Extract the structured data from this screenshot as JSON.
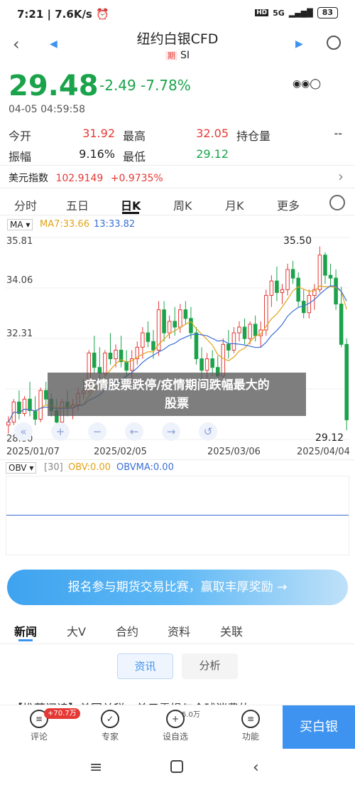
{
  "status": {
    "time": "7:21",
    "speed": "7.6K/s",
    "network": "5G",
    "battery": "83"
  },
  "header": {
    "title": "纽约白银CFD",
    "tag": "期",
    "code": "SI"
  },
  "quote": {
    "price": "29.48",
    "change": "-2.49",
    "change_pct": "-7.78%",
    "timestamp": "04-05 04:59:58"
  },
  "stats": {
    "open_label": "今开",
    "open": "31.92",
    "high_label": "最高",
    "high": "32.05",
    "oi_label": "持仓量",
    "oi": "--",
    "amp_label": "振幅",
    "amp": "9.16%",
    "low_label": "最低",
    "low": "29.12"
  },
  "usd_index": {
    "label": "美元指数",
    "value": "102.9149",
    "change": "+0.9735%"
  },
  "period_tabs": [
    "分时",
    "五日",
    "日K",
    "周K",
    "月K",
    "更多"
  ],
  "legend": {
    "ma": "MA",
    "ma7": "MA7:33.66",
    "ma_other": "13:33.82"
  },
  "y_ticks": [
    "35.81",
    "34.06",
    "32.31",
    "28.80"
  ],
  "price_labels": {
    "high": "35.50",
    "low": "29.12"
  },
  "x_dates": [
    "2025/01/07",
    "2025/02/05",
    "2025/03/06",
    "2025/04/04"
  ],
  "overlay_text": {
    "line1": "疫情股票跌停/疫情期间跌幅最大的",
    "line2": "股票"
  },
  "obv": {
    "label": "OBV",
    "param": "[30]",
    "obv": "OBV:0.00",
    "obvma": "OBVMA:0.00"
  },
  "banner": {
    "text": "报名参与期货交易比赛，赢取丰厚奖励 →"
  },
  "content_tabs": [
    "新闻",
    "大V",
    "合约",
    "资料",
    "关联"
  ],
  "sub_tabs": [
    "资讯",
    "分析"
  ],
  "news_headline": "【推荐阅读】美国关税，美元震损与全球消费的",
  "bottom_nav": [
    {
      "label": "评论",
      "badge": "+70.7万"
    },
    {
      "label": "专家"
    },
    {
      "label": "设自选",
      "badge": "5.0万"
    },
    {
      "label": "功能"
    }
  ],
  "buy_button": "买白银",
  "colors": {
    "up": "#e53935",
    "down": "#1aa34a",
    "accent": "#3e93f0"
  },
  "chart_data": {
    "type": "candlestick",
    "title": "",
    "ylim": [
      28.8,
      35.81
    ],
    "x_range": [
      "2025/01/07",
      "2025/04/04"
    ],
    "candles": [
      [
        29.3,
        29.6,
        29.0,
        29.4
      ],
      [
        29.4,
        30.2,
        29.3,
        30.1
      ],
      [
        30.1,
        30.5,
        29.5,
        29.7
      ],
      [
        29.7,
        30.3,
        29.6,
        30.2
      ],
      [
        30.2,
        30.8,
        29.6,
        29.8
      ],
      [
        29.8,
        30.3,
        29.3,
        29.5
      ],
      [
        29.5,
        30.6,
        29.4,
        30.5
      ],
      [
        30.5,
        30.8,
        30.0,
        30.2
      ],
      [
        30.2,
        30.4,
        29.6,
        29.8
      ],
      [
        29.8,
        30.2,
        29.2,
        29.4
      ],
      [
        29.4,
        30.2,
        29.3,
        30.1
      ],
      [
        30.1,
        30.5,
        29.6,
        29.9
      ],
      [
        29.9,
        30.2,
        29.5,
        30.0
      ],
      [
        30.0,
        30.6,
        29.8,
        30.4
      ],
      [
        30.4,
        30.9,
        30.2,
        30.5
      ],
      [
        30.5,
        31.9,
        30.4,
        31.8
      ],
      [
        31.8,
        32.4,
        31.1,
        31.3
      ],
      [
        31.3,
        32.0,
        30.8,
        31.1
      ],
      [
        31.1,
        31.9,
        31.0,
        31.8
      ],
      [
        31.8,
        32.5,
        31.4,
        31.6
      ],
      [
        31.6,
        32.1,
        31.3,
        31.9
      ],
      [
        31.9,
        32.4,
        31.3,
        31.5
      ],
      [
        31.5,
        31.9,
        30.9,
        31.2
      ],
      [
        31.2,
        31.9,
        30.8,
        31.6
      ],
      [
        31.6,
        32.2,
        31.4,
        32.0
      ],
      [
        32.0,
        32.7,
        31.6,
        32.5
      ],
      [
        32.5,
        32.9,
        32.0,
        32.2
      ],
      [
        32.2,
        32.6,
        31.6,
        31.9
      ],
      [
        31.9,
        33.6,
        31.7,
        33.3
      ],
      [
        33.3,
        33.6,
        32.2,
        32.5
      ],
      [
        32.5,
        33.1,
        32.3,
        32.9
      ],
      [
        32.9,
        33.4,
        32.4,
        32.7
      ],
      [
        32.7,
        33.5,
        32.5,
        33.3
      ],
      [
        33.3,
        33.6,
        32.8,
        33.0
      ],
      [
        33.0,
        33.4,
        32.3,
        32.5
      ],
      [
        32.5,
        32.7,
        31.4,
        31.6
      ],
      [
        31.6,
        32.0,
        30.8,
        31.2
      ],
      [
        31.2,
        31.8,
        30.9,
        31.6
      ],
      [
        31.6,
        31.9,
        31.0,
        31.3
      ],
      [
        31.3,
        31.7,
        30.8,
        31.0
      ],
      [
        31.0,
        32.3,
        30.9,
        32.1
      ],
      [
        32.1,
        32.6,
        31.6,
        31.9
      ],
      [
        31.9,
        32.7,
        31.8,
        32.5
      ],
      [
        32.5,
        32.9,
        32.2,
        32.7
      ],
      [
        32.7,
        33.0,
        32.1,
        32.3
      ],
      [
        32.3,
        32.9,
        32.1,
        32.8
      ],
      [
        32.8,
        33.1,
        32.2,
        32.4
      ],
      [
        32.4,
        32.9,
        32.0,
        32.6
      ],
      [
        32.6,
        34.0,
        32.4,
        33.8
      ],
      [
        33.8,
        34.5,
        33.4,
        34.3
      ],
      [
        34.3,
        34.8,
        33.6,
        33.9
      ],
      [
        33.9,
        34.2,
        33.5,
        34.0
      ],
      [
        34.0,
        34.9,
        33.8,
        34.7
      ],
      [
        34.7,
        35.0,
        34.2,
        34.4
      ],
      [
        34.4,
        34.6,
        33.4,
        33.6
      ],
      [
        33.6,
        34.0,
        33.0,
        33.2
      ],
      [
        33.2,
        34.0,
        33.0,
        33.8
      ],
      [
        33.8,
        34.2,
        33.3,
        34.0
      ],
      [
        34.0,
        35.5,
        33.9,
        35.2
      ],
      [
        35.2,
        35.3,
        34.2,
        34.5
      ],
      [
        34.5,
        34.9,
        34.1,
        34.4
      ],
      [
        34.4,
        34.7,
        33.3,
        33.5
      ],
      [
        33.5,
        34.1,
        32.0,
        32.1
      ],
      [
        32.1,
        32.3,
        29.12,
        29.48
      ]
    ]
  }
}
